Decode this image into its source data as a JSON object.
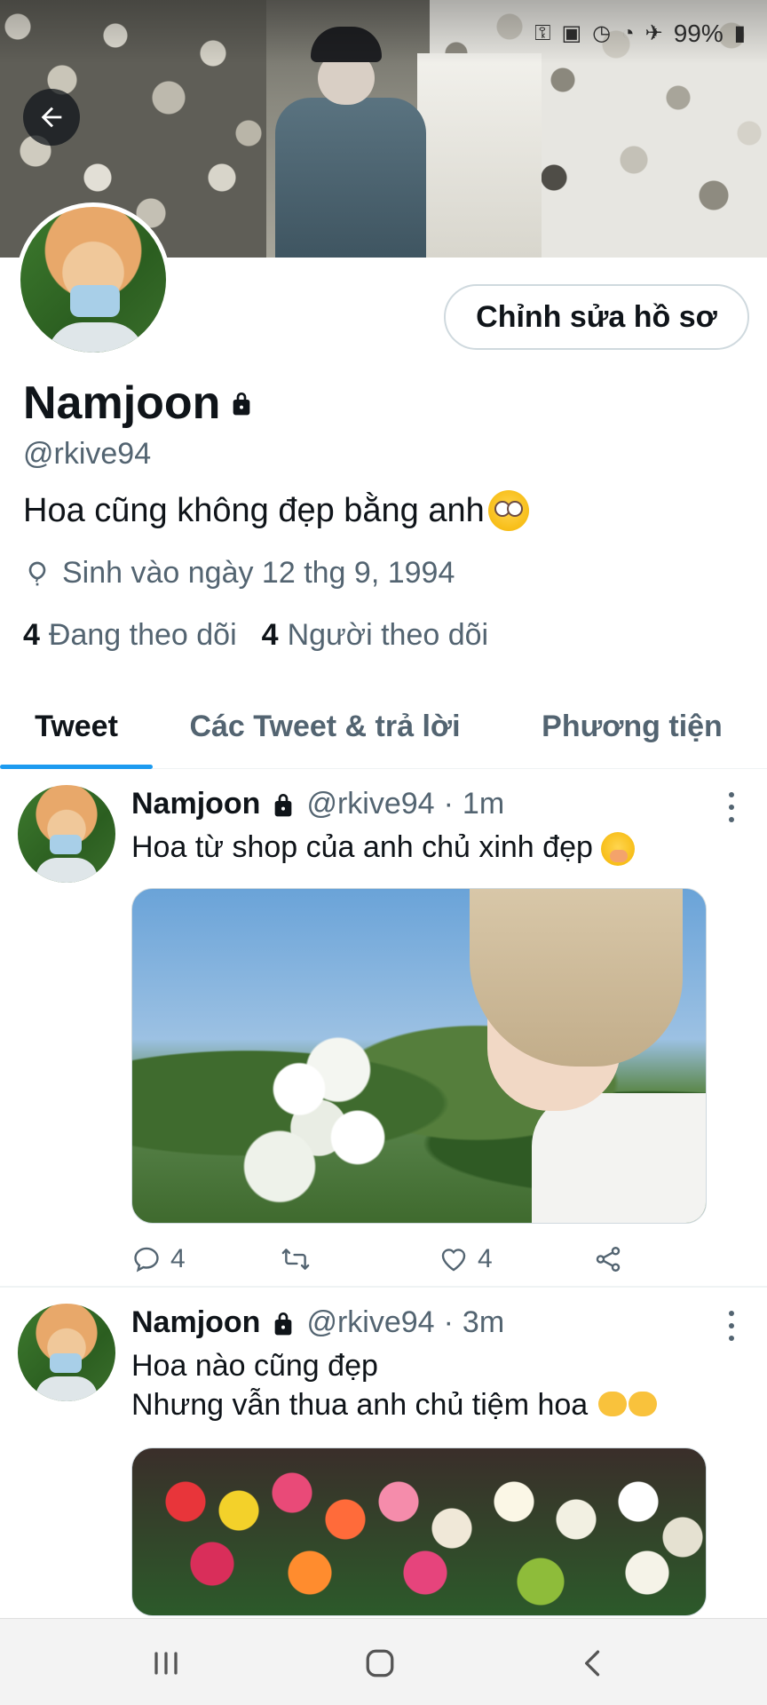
{
  "status_bar": {
    "battery_percent": "99%"
  },
  "profile": {
    "display_name": "Namjoon",
    "handle": "@rkive94",
    "bio": "Hoa cũng không đẹp bằng anh",
    "birth": "Sinh vào ngày 12 thg 9, 1994",
    "following_count": "4",
    "following_label": "Đang theo dõi",
    "followers_count": "4",
    "followers_label": "Người theo dõi",
    "edit_button_label": "Chỉnh sửa hồ sơ"
  },
  "tabs": [
    {
      "label": "Tweet",
      "active": true
    },
    {
      "label": "Các Tweet & trả lời",
      "active": false
    },
    {
      "label": "Phương tiện",
      "active": false
    }
  ],
  "tweets": [
    {
      "name": "Namjoon",
      "handle": "@rkive94",
      "dot": "·",
      "time": "1m",
      "text": "Hoa từ shop của anh chủ xinh đẹp",
      "reply_count": "4",
      "like_count": "4"
    },
    {
      "name": "Namjoon",
      "handle": "@rkive94",
      "dot": "·",
      "time": "3m",
      "text_line1": "Hoa nào cũng đẹp",
      "text_line2": "Nhưng vẫn thua anh chủ tiệm hoa"
    }
  ],
  "colors": {
    "accent": "#1d9bf0",
    "text_primary": "#0f1419",
    "text_secondary": "#536471"
  }
}
